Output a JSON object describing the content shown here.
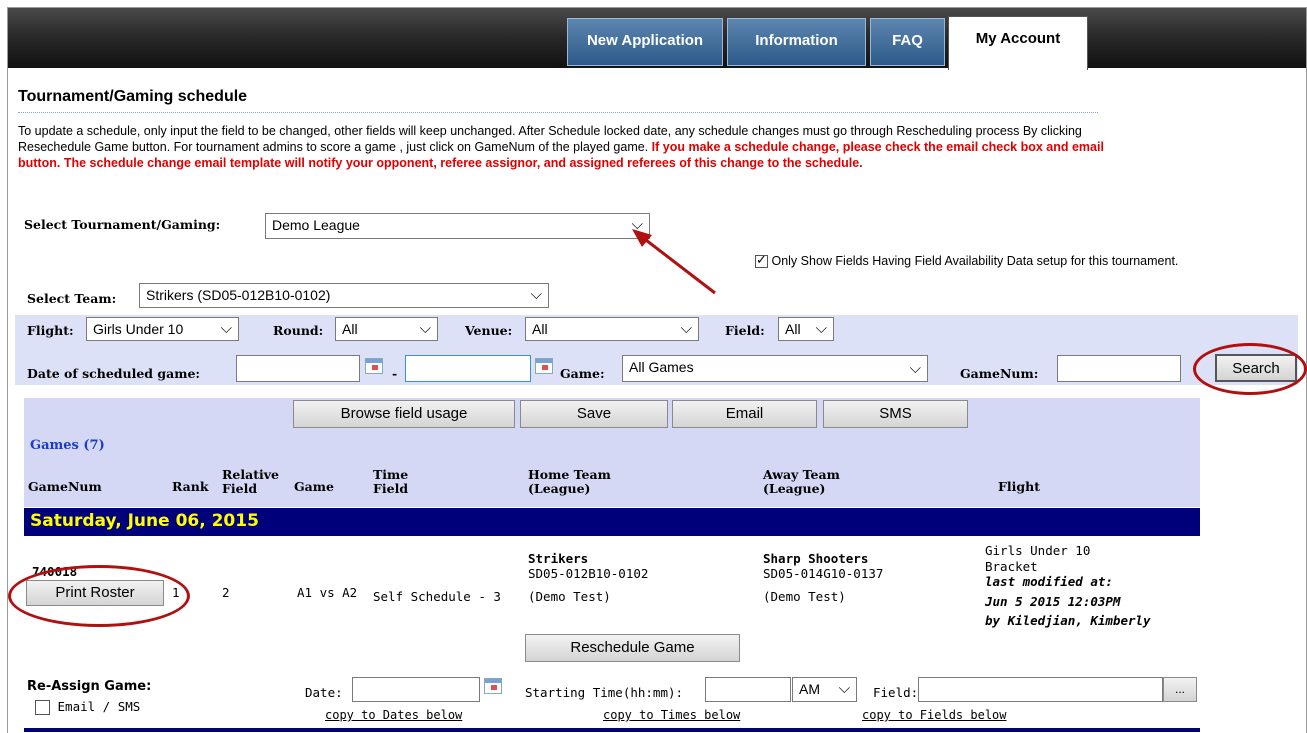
{
  "nav": {
    "tabs": [
      "New Application",
      "Information",
      "FAQ",
      "My Account"
    ]
  },
  "page": {
    "title": "Tournament/Gaming schedule",
    "intro": "To update a schedule, only input the field to be changed, other fields will keep unchanged. After Schedule locked date, any schedule changes must go through Rescheduling process By clicking Resechedule Game button. For tournament admins to score a game , just click on GameNum of the played game.",
    "intro_red": "If you make a schedule change, please check the email check box and email button. The schedule change email template will notify your opponent, referee assignor, and assigned referees of this change to the schedule."
  },
  "filters": {
    "tournament_label": "Select Tournament/Gaming:",
    "tournament_value": "Demo League",
    "only_show_fields": "Only Show Fields Having Field Availability Data setup for this tournament.",
    "team_label": "Select Team:",
    "team_value": "Strikers (SD05-012B10-0102)",
    "flight_label": "Flight:",
    "flight_value": "Girls Under 10",
    "round_label": "Round:",
    "round_value": "All",
    "venue_label": "Venue:",
    "venue_value": "All",
    "field_label": "Field:",
    "field_value": "All",
    "date_label": "Date of scheduled game:",
    "date_sep": "-",
    "game_label": "Game:",
    "game_value": "All Games",
    "gamenum_label": "GameNum:",
    "search_button": "Search"
  },
  "toolbar": {
    "games_count": "Games (7)",
    "browse": "Browse field usage",
    "save": "Save",
    "email": "Email",
    "sms": "SMS"
  },
  "columns": {
    "gamenum": "GameNum",
    "rank": "Rank",
    "relative_field_1": "Relative",
    "relative_field_2": "Field",
    "game": "Game",
    "time_field_1": "Time",
    "time_field_2": "Field",
    "home_1": "Home Team",
    "home_2": "(League)",
    "away_1": "Away Team",
    "away_2": "(League)",
    "flight": "Flight"
  },
  "day_header": "Saturday, June 06, 2015",
  "game_row": {
    "gamenum": "740018",
    "print_roster": "Print Roster",
    "rank": "1",
    "relative_field": "2",
    "game": "A1 vs A2",
    "time_field": "Self Schedule - 3",
    "home_name": "Strikers",
    "home_id": "SD05-012B10-0102",
    "home_league": "(Demo Test)",
    "away_name": "Sharp Shooters",
    "away_id": "SD05-014G10-0137",
    "away_league": "(Demo Test)",
    "flight_1": "Girls Under 10",
    "flight_2": "Bracket",
    "modified_label": "last modified at:",
    "modified_date": "Jun 5 2015 12:03PM",
    "modified_by": "by Kiledjian, Kimberly",
    "reschedule": "Reschedule Game"
  },
  "reassign": {
    "label": "Re-Assign Game:",
    "email_sms": "Email / SMS",
    "date_label": "Date:",
    "time_label": "Starting Time(hh:mm):",
    "ampm": "AM",
    "field_label": "Field:",
    "browse_dots": "...",
    "copy_dates": "copy to Dates below",
    "copy_times": "copy to Times below",
    "copy_fields": "copy to Fields below"
  },
  "colors": {
    "header_band": "#d4d8f4",
    "day_band": "#00007a",
    "day_text": "#ffff00",
    "link_blue": "#1a3ccf",
    "annotation": "#b01010"
  }
}
